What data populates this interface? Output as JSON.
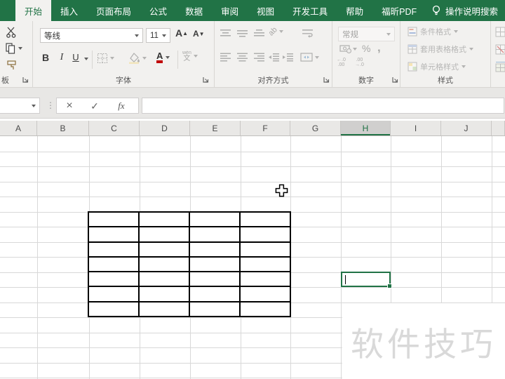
{
  "colors": {
    "accent": "#217346",
    "watermark": "#d9d9d9",
    "table_border": "#000000",
    "font_color_swatch": "#c00000"
  },
  "tab_bar": {
    "tabs": [
      {
        "label": "开始",
        "active": true
      },
      {
        "label": "插入",
        "active": false
      },
      {
        "label": "页面布局",
        "active": false
      },
      {
        "label": "公式",
        "active": false
      },
      {
        "label": "数据",
        "active": false
      },
      {
        "label": "审阅",
        "active": false
      },
      {
        "label": "视图",
        "active": false
      },
      {
        "label": "开发工具",
        "active": false
      },
      {
        "label": "帮助",
        "active": false
      },
      {
        "label": "福昕PDF",
        "active": false
      }
    ],
    "tell_me_label": "操作说明搜索"
  },
  "ribbon": {
    "clipboard": {
      "label": "板"
    },
    "font": {
      "family": "等线",
      "size": "11",
      "bold": "B",
      "italic": "I",
      "underline": "U",
      "phonetic": "文",
      "label": "字体"
    },
    "alignment": {
      "label": "对齐方式"
    },
    "number": {
      "format": "常规",
      "percent": "%",
      "comma": ",",
      "increase_decimal": "←.0\n.00",
      "decrease_decimal": ".00\n→.0",
      "label": "数字"
    },
    "styles": {
      "conditional": "条件格式",
      "format_as_table": "套用表格格式",
      "cell_styles": "单元格样式",
      "label": "样式"
    }
  },
  "formula_bar": {
    "name_box_value": "",
    "formula_value": "",
    "cancel": "×",
    "enter": "✓",
    "fx_label": "fx"
  },
  "sheet": {
    "column_letters": [
      "A",
      "B",
      "C",
      "D",
      "E",
      "F",
      "G",
      "H",
      "I",
      "J",
      ""
    ],
    "selected_column": "H",
    "visible_row_count": 16,
    "table": {
      "columns": 4,
      "rows": 7
    },
    "watermark": {
      "text": "软件技巧"
    },
    "selection": {
      "column": "H",
      "editing_cursor": true,
      "fill_handle": true
    }
  }
}
